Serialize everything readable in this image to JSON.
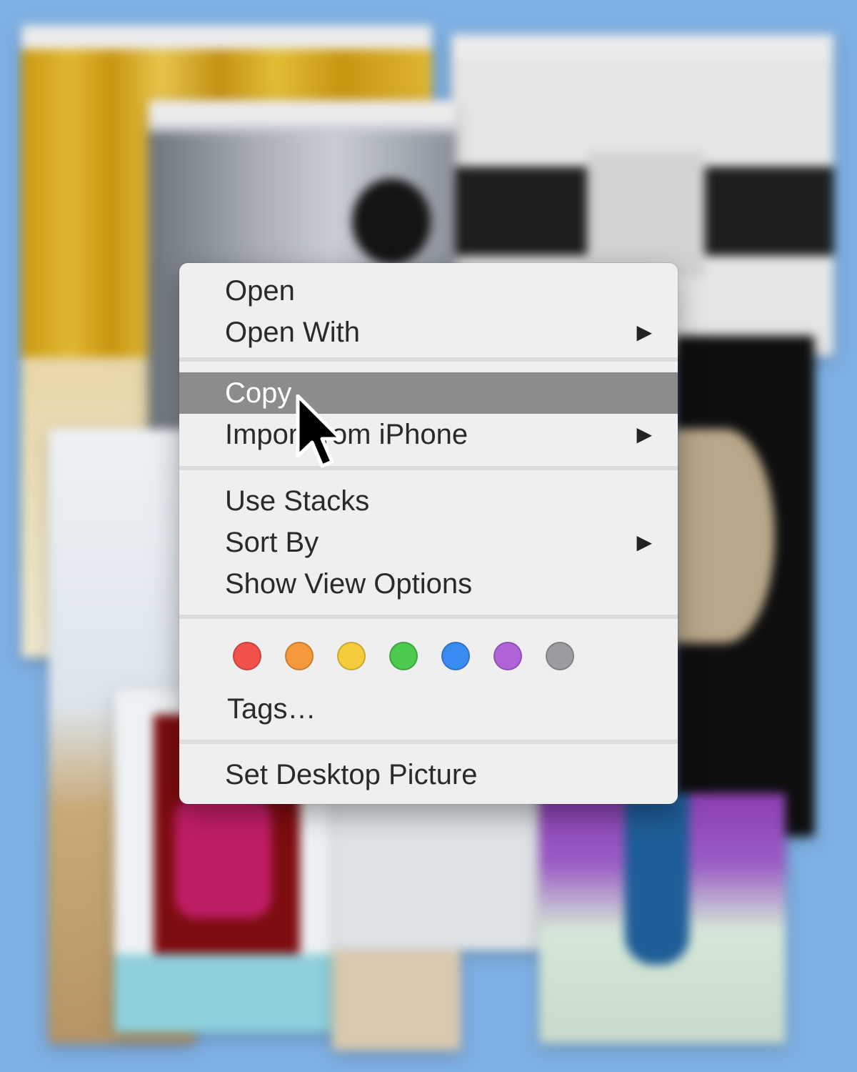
{
  "context_menu": {
    "items": [
      {
        "label": "Open",
        "has_submenu": false
      },
      {
        "label": "Open With",
        "has_submenu": true
      },
      {
        "label": "Copy",
        "has_submenu": false,
        "highlighted": true
      },
      {
        "label": "Import from iPhone",
        "has_submenu": true
      },
      {
        "label": "Use Stacks",
        "has_submenu": false
      },
      {
        "label": "Sort By",
        "has_submenu": true
      },
      {
        "label": "Show View Options",
        "has_submenu": false
      },
      {
        "label": "Tags…",
        "has_submenu": false
      },
      {
        "label": "Set Desktop Picture",
        "has_submenu": false
      }
    ],
    "submenu_arrow": "▶",
    "tag_colors": [
      {
        "name": "red",
        "color": "#f2514b"
      },
      {
        "name": "orange",
        "color": "#f49a3c"
      },
      {
        "name": "yellow",
        "color": "#f5cd3c"
      },
      {
        "name": "green",
        "color": "#4cc94f"
      },
      {
        "name": "blue",
        "color": "#3a8bf1"
      },
      {
        "name": "purple",
        "color": "#b064d7"
      },
      {
        "name": "gray",
        "color": "#9c9ca0"
      }
    ]
  },
  "colors": {
    "desktop": "#7fb0e3",
    "menu_background": "#efefef",
    "highlight": "#8c8c8c"
  }
}
